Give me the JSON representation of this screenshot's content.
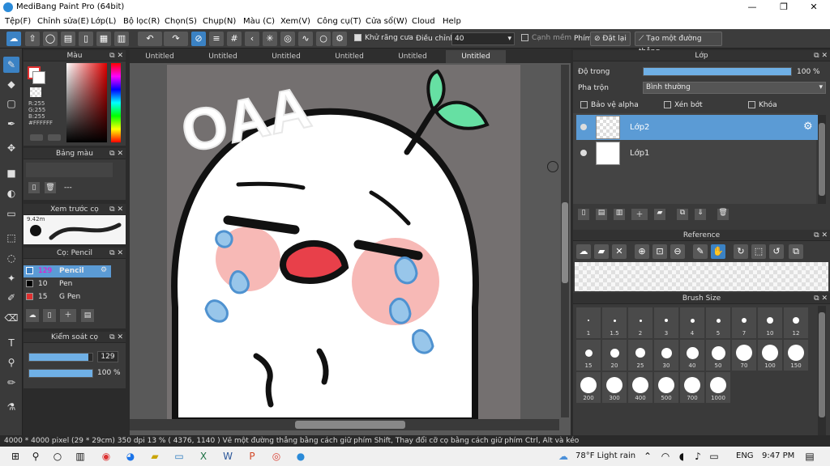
{
  "title_bar": {
    "title": "MediBang Paint Pro (64bit)",
    "minimize": "—",
    "maximize": "❐",
    "close": "✕"
  },
  "menu": [
    "Tệp(F)",
    "Chỉnh sửa(E)",
    "Lớp(L)",
    "Bộ lọc(R)",
    "Chọn(S)",
    "Chụp(N)",
    "Màu (C)",
    "Xem(V)",
    "Công cụ(T)",
    "Cửa sổ(W)",
    "Cloud",
    "Help"
  ],
  "toolbar": {
    "antialias_label": "Khử răng cưa",
    "adjust_label": "Điều chỉnh",
    "adjust_value": "40",
    "smooth_label": "Cạnh mềm",
    "key_label": "Phím",
    "reset_label": "Đặt lại",
    "create_line_label": "Tạo một đường thẳng"
  },
  "color_panel": {
    "title": "Màu",
    "r": "R:255",
    "g": "G:255",
    "b": "B:255",
    "hex": "#FFFFFF"
  },
  "palette_panel": {
    "title": "Bảng màu",
    "value": "---"
  },
  "brush_preview": {
    "title": "Xem trước cọ",
    "size": "9.42m"
  },
  "brush_panel": {
    "title": "Cọ: Pencil",
    "items": [
      {
        "size": "129",
        "name": "Pencil",
        "color": "#3a7fc4"
      },
      {
        "size": "10",
        "name": "Pen",
        "color": "#000000"
      },
      {
        "size": "15",
        "name": "G Pen",
        "color": "#e03030"
      }
    ]
  },
  "brush_control": {
    "title": "Kiểm soát cọ",
    "size_value": "129",
    "opacity_value": "100 %",
    "size_fraction": 0.93,
    "opacity_fraction": 1.0
  },
  "tabs": [
    "Untitled",
    "Untitled",
    "Untitled",
    "Untitled",
    "Untitled",
    "Untitled"
  ],
  "canvas": {
    "text": "OAA"
  },
  "layer_panel": {
    "title": "Lớp",
    "opacity_label": "Độ trong",
    "opacity_value": "100 %",
    "blend_label": "Pha trộn",
    "blend_value": "Bình thường",
    "protect_alpha": "Bảo vệ alpha",
    "clipping": "Xén bớt",
    "lock": "Khóa",
    "layers": [
      "Lớp2",
      "Lớp1"
    ]
  },
  "reference_panel": {
    "title": "Reference"
  },
  "brush_size_panel": {
    "title": "Brush Size",
    "sizes": [
      "1",
      "1.5",
      "2",
      "3",
      "4",
      "5",
      "7",
      "10",
      "12",
      "15",
      "20",
      "25",
      "30",
      "40",
      "50",
      "70",
      "100",
      "150",
      "200",
      "300",
      "400",
      "500",
      "700",
      "1000"
    ]
  },
  "status_bar": {
    "text": "4000 * 4000 pixel   (29 * 29cm)   350 dpi   13 %   ( 4376, 1140 )   Vẽ một đường thẳng bằng cách giữ phím Shift, Thay đổi cỡ cọ bằng cách giữ phím Ctrl, Alt và kéo"
  },
  "taskbar": {
    "weather": "78°F  Light rain",
    "lang": "ENG",
    "time": "9:47 PM"
  }
}
